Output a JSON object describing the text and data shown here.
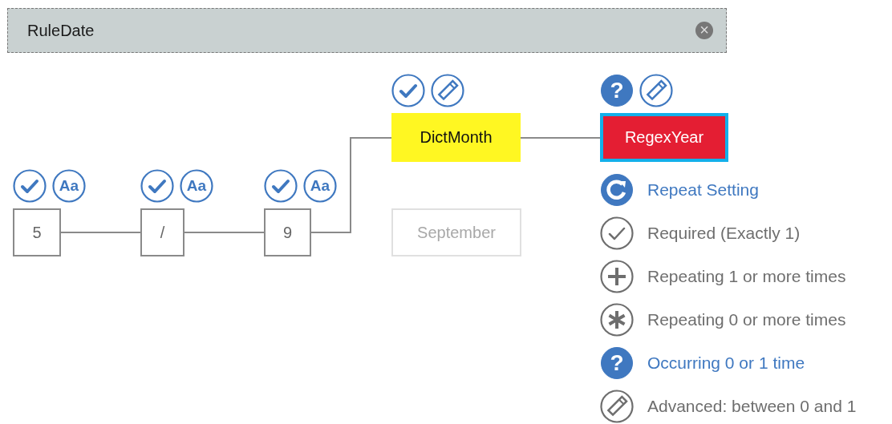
{
  "rule": {
    "title": "RuleDate",
    "close_glyph": "×"
  },
  "nodes": [
    {
      "label": "5",
      "kind": "token",
      "selected": false,
      "badges": [
        {
          "kind": "check"
        },
        {
          "kind": "case",
          "glyph": "Aa"
        }
      ]
    },
    {
      "label": "/",
      "kind": "token",
      "selected": false,
      "badges": [
        {
          "kind": "check"
        },
        {
          "kind": "case",
          "glyph": "Aa"
        }
      ]
    },
    {
      "label": "9",
      "kind": "token",
      "selected": false,
      "badges": [
        {
          "kind": "check"
        },
        {
          "kind": "case",
          "glyph": "Aa"
        }
      ]
    },
    {
      "label": "DictMonth",
      "kind": "dictionary",
      "selected": false,
      "badges": [
        {
          "kind": "check"
        },
        {
          "kind": "edit"
        }
      ]
    },
    {
      "label": "September",
      "kind": "ghost",
      "selected": false
    },
    {
      "label": "RegexYear",
      "kind": "regex",
      "selected": true,
      "badges": [
        {
          "kind": "optional",
          "glyph": "?"
        },
        {
          "kind": "edit"
        }
      ]
    }
  ],
  "repeat_menu": {
    "title": "Repeat Setting",
    "options": [
      {
        "label": "Required (Exactly 1)",
        "kind": "required",
        "selected": false
      },
      {
        "label": "Repeating 1 or more times",
        "kind": "plus",
        "selected": false
      },
      {
        "label": "Repeating 0 or more times",
        "kind": "star",
        "selected": false
      },
      {
        "label": "Occurring 0 or 1 time",
        "kind": "optional",
        "glyph": "?",
        "selected": true
      },
      {
        "label": "Advanced: between 0 and 1",
        "kind": "advanced",
        "selected": false
      }
    ]
  }
}
